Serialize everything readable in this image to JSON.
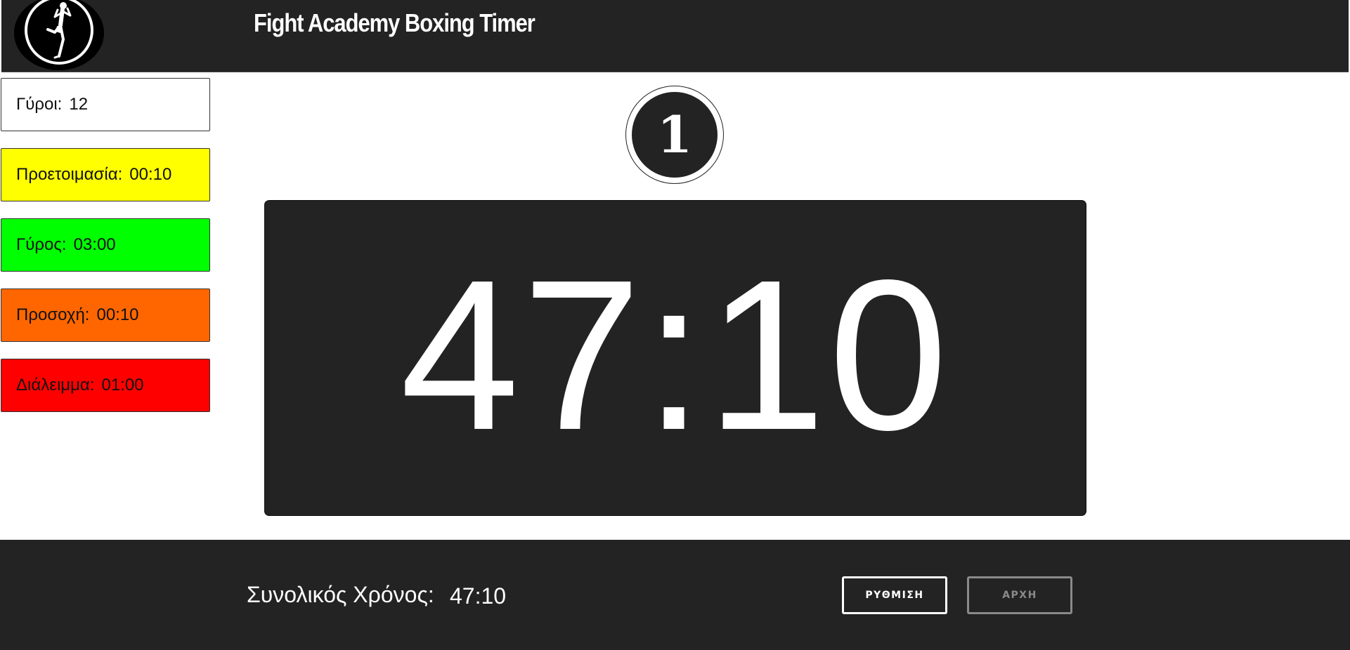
{
  "header": {
    "title": "Fight Academy Boxing Timer",
    "logo_icon": "muay-thai-fighter-logo"
  },
  "settings_panel": {
    "rounds": {
      "label": "Γύροι:",
      "value": "12",
      "color": "#ffffff"
    },
    "prepare": {
      "label": "Προετοιμασία:",
      "value": "00:10",
      "color": "#ffff00"
    },
    "round": {
      "label": "Γύρος:",
      "value": "03:00",
      "color": "#00ff00"
    },
    "warning": {
      "label": "Προσοχή:",
      "value": "00:10",
      "color": "#ff6600"
    },
    "rest": {
      "label": "Διάλειμμα:",
      "value": "01:00",
      "color": "#ff0000"
    }
  },
  "round_indicator": {
    "value": "1"
  },
  "timer": {
    "display": "47:10"
  },
  "footer": {
    "total_label": "Συνολικός Χρόνος:",
    "total_value": "47:10",
    "settings_button": "ΡΥΘΜΙΣΗ",
    "start_button": "ΑΡΧΗ"
  },
  "colors": {
    "dark_bg": "#232323",
    "page_bg": "#ffffff",
    "disabled": "#8a8a8a"
  }
}
